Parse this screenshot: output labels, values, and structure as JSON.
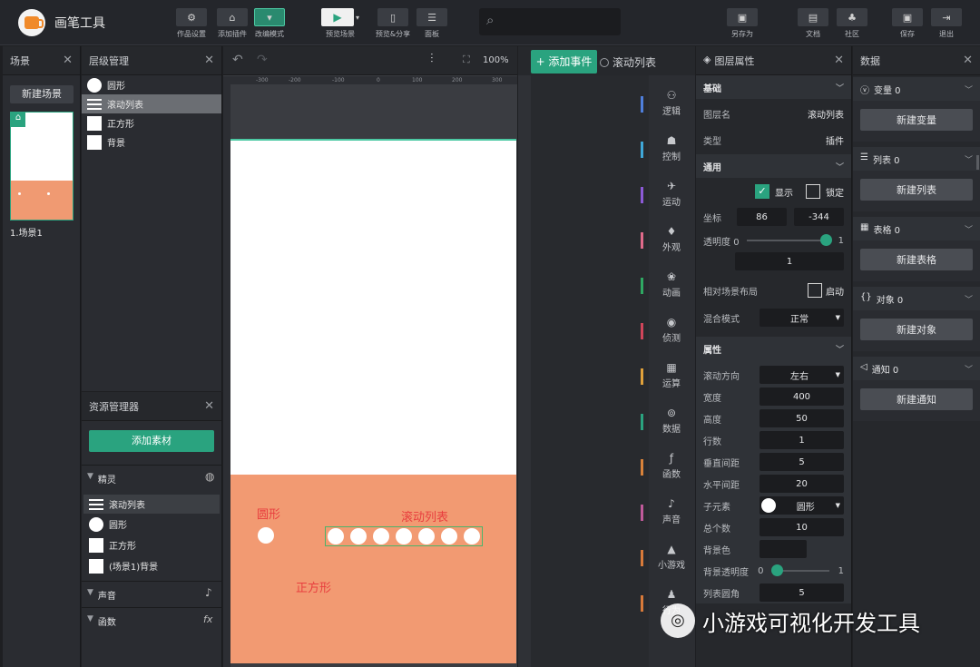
{
  "app": {
    "title": "画笔工具"
  },
  "toolbar": {
    "work_settings": "作品设置",
    "add_plugin": "添加插件",
    "edit_mode": "改编模式",
    "preview_scene": "预览场景",
    "preview_share": "预览&分享",
    "panel": "面板",
    "save_as": "另存为",
    "docs": "文档",
    "community": "社区",
    "save": "保存",
    "exit": "退出"
  },
  "scenes": {
    "title": "场景",
    "new_btn": "新建场景",
    "items": [
      {
        "label": "1.场景1"
      }
    ]
  },
  "layers": {
    "title": "层级管理",
    "items": [
      {
        "label": "圆形",
        "icon": "circle-icon"
      },
      {
        "label": "滚动列表",
        "icon": "list-icon"
      },
      {
        "label": "正方形",
        "icon": "square-icon"
      },
      {
        "label": "背景",
        "icon": "square-icon"
      }
    ]
  },
  "assets": {
    "title": "资源管理器",
    "add_btn": "添加素材",
    "sprites_label": "精灵",
    "sprites": [
      {
        "label": "滚动列表"
      },
      {
        "label": "圆形"
      },
      {
        "label": "正方形"
      },
      {
        "label": "(场景1)背景"
      }
    ],
    "sound_label": "声音",
    "func_label": "函数"
  },
  "canvas": {
    "zoom": "100%",
    "ruler_top": [
      "-200",
      "-100",
      "0",
      "100",
      "200",
      "300"
    ],
    "ruler_top2": [
      "-300"
    ],
    "label_circle": "圆形",
    "label_list": "滚动列表",
    "label_square": "正方形"
  },
  "events": {
    "add_btn": "+ 添加事件",
    "selected": "滚动列表"
  },
  "categories": [
    {
      "label": "逻辑",
      "color": "#4f7fdc"
    },
    {
      "label": "控制",
      "color": "#3fa7d8"
    },
    {
      "label": "运动",
      "color": "#8c5ad6"
    },
    {
      "label": "外观",
      "color": "#e06a8a"
    },
    {
      "label": "动画",
      "color": "#2fa862"
    },
    {
      "label": "侦测",
      "color": "#d0455a"
    },
    {
      "label": "运算",
      "color": "#e0a13b"
    },
    {
      "label": "数据",
      "color": "#2aa37f"
    },
    {
      "label": "函数",
      "color": "#d8823a"
    },
    {
      "label": "声音",
      "color": "#c05a9a"
    },
    {
      "label": "小游戏",
      "color": "#d87a3a"
    },
    {
      "label": "行为",
      "color": "#d87a3a"
    }
  ],
  "props": {
    "title": "图层属性",
    "basic": "基础",
    "layer_name_label": "图层名",
    "layer_name": "滚动列表",
    "type_label": "类型",
    "type": "插件",
    "general": "通用",
    "show": "显示",
    "lock": "锁定",
    "coord_label": "坐标",
    "x": "86",
    "y": "-344",
    "opacity_label": "透明度",
    "opacity_min": "0",
    "opacity_max": "1",
    "opacity": "1",
    "relative_label": "相对场景布局",
    "relative_val": "启动",
    "blend_label": "混合模式",
    "blend": "正常",
    "attrs": "属性",
    "scroll_dir_label": "滚动方向",
    "scroll_dir": "左右",
    "width_label": "宽度",
    "width": "400",
    "height_label": "高度",
    "height": "50",
    "rows_label": "行数",
    "rows": "1",
    "vgap_label": "垂直间距",
    "vgap": "5",
    "hgap_label": "水平间距",
    "hgap": "20",
    "child_label": "子元素",
    "child": "圆形",
    "total_label": "总个数",
    "total": "10",
    "bgcolor_label": "背景色",
    "bgopacity_label": "背景透明度",
    "bgopacity_min": "0",
    "bgopacity_max": "1",
    "radius_label": "列表圆角",
    "radius": "5"
  },
  "data": {
    "title": "数据",
    "sections": [
      {
        "label": "变量 0",
        "btn": "新建变量",
        "icon": "var-icon"
      },
      {
        "label": "列表 0",
        "btn": "新建列表",
        "icon": "list-icon"
      },
      {
        "label": "表格 0",
        "btn": "新建表格",
        "icon": "table-icon"
      },
      {
        "label": "对象 0",
        "btn": "新建对象",
        "icon": "object-icon"
      },
      {
        "label": "通知 0",
        "btn": "新建通知",
        "icon": "notice-icon"
      }
    ]
  },
  "watermark": "小游戏可视化开发工具"
}
